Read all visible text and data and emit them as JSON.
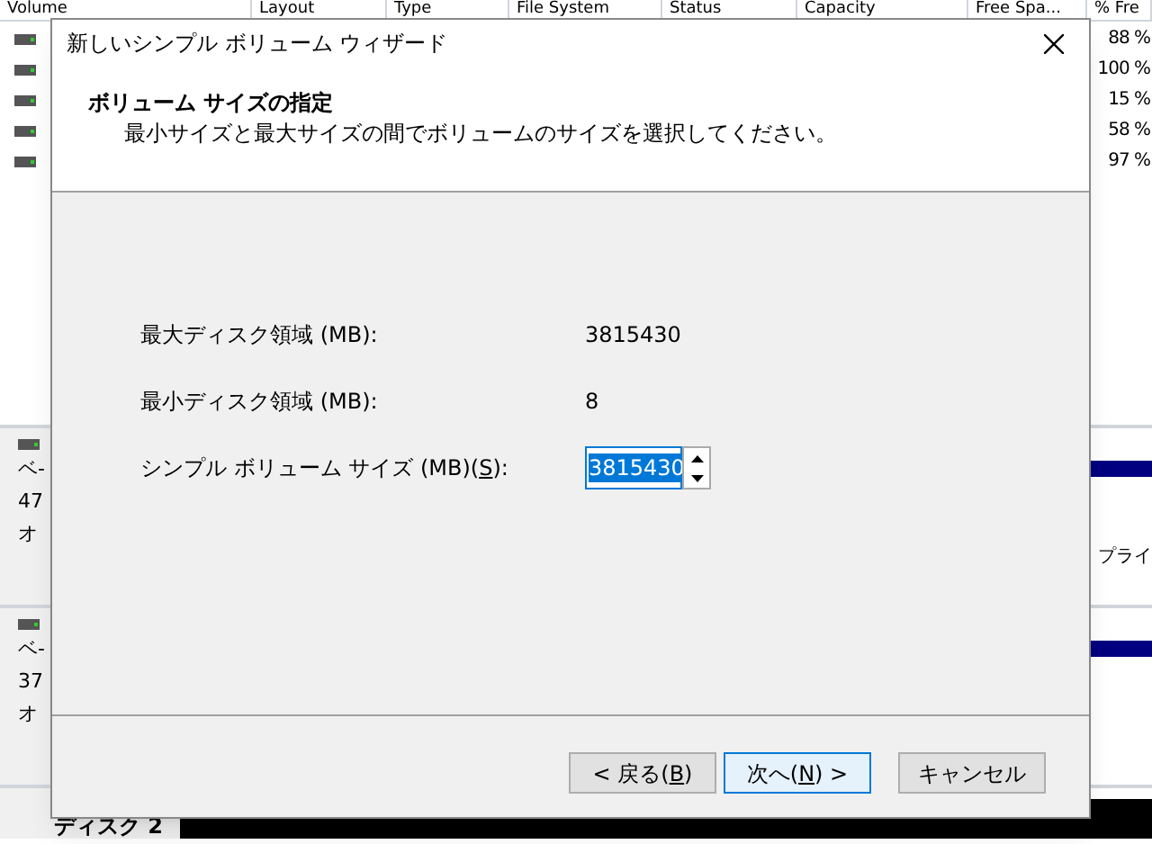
{
  "background_window": {
    "columns": [
      "Volume",
      "Layout",
      "Type",
      "File System",
      "Status",
      "Capacity",
      "Free Spa...",
      "% Fre"
    ],
    "rows": [
      {
        "percent_free": "88 %"
      },
      {
        "percent_free": "100 %"
      },
      {
        "percent_free": "15 %"
      },
      {
        "percent_free": "58 %"
      },
      {
        "percent_free": "97 %"
      }
    ],
    "disks": [
      {
        "lines": [
          "ベ-",
          "47",
          "オ"
        ],
        "partition": "プライ"
      },
      {
        "lines": [
          "ベ-",
          "37",
          "オ"
        ]
      }
    ],
    "last_disk": "ディスク 2"
  },
  "dialog": {
    "title": "新しいシンプル ボリューム ウィザード",
    "heading": "ボリューム サイズの指定",
    "subheading": "最小サイズと最大サイズの間でボリュームのサイズを選択してください。",
    "fields": [
      {
        "kind": "text",
        "label": {
          "before": "最大ディスク領域 (MB):"
        },
        "value": "3815430"
      },
      {
        "kind": "text",
        "label": {
          "before": "最小ディスク領域 (MB):"
        },
        "value": "8"
      },
      {
        "kind": "spin",
        "label": {
          "before": "シンプル ボリューム サイズ (MB)(",
          "mnemonic": "S",
          "after": "):"
        },
        "value": "3815430"
      }
    ],
    "buttons": [
      {
        "label": {
          "before": "< 戻る(",
          "mnemonic": "B",
          "after": ")"
        },
        "default": false
      },
      {
        "label": {
          "before": "次へ(",
          "mnemonic": "N",
          "after": ") >"
        },
        "default": true
      },
      {
        "label": {
          "before": "キャンセル"
        },
        "default": false
      }
    ]
  }
}
